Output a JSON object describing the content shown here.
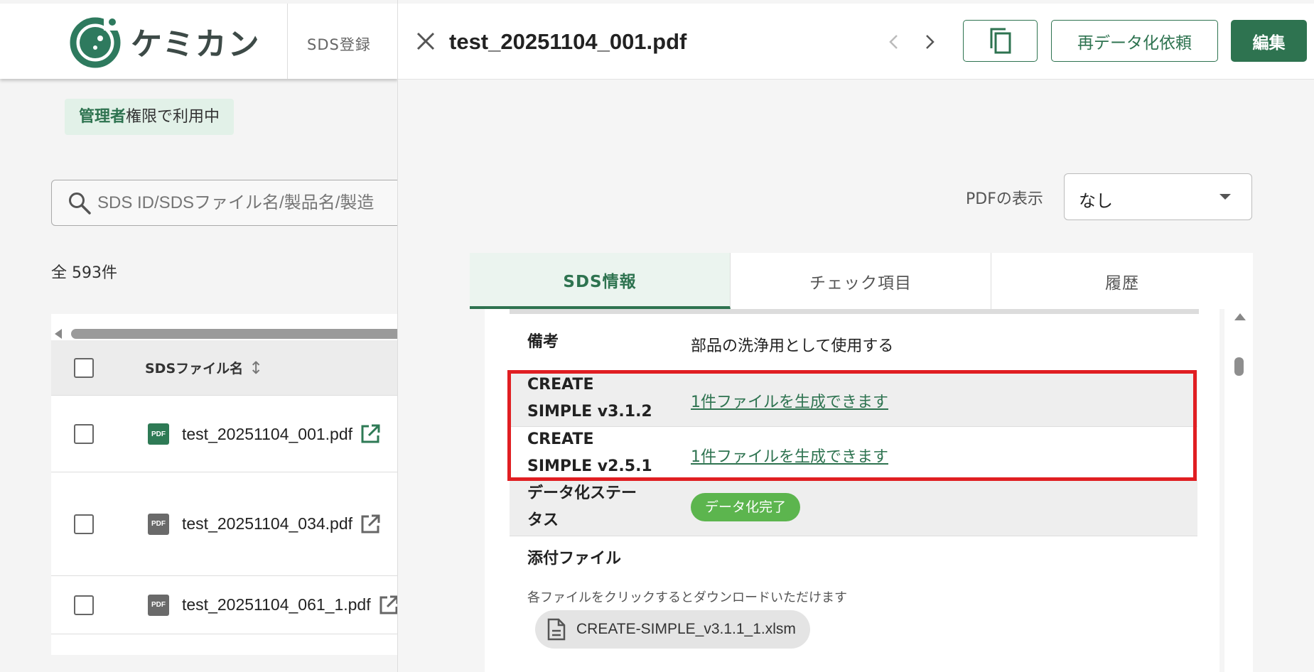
{
  "app": {
    "logo_text": "ケミカン",
    "nav_sds_register": "SDS登録"
  },
  "admin_badge": {
    "strong": "管理者",
    "rest": "権限で利用中"
  },
  "search": {
    "placeholder": "SDS ID/SDSファイル名/製品名/製造"
  },
  "total_count": "全 593件",
  "table": {
    "header_filename": "SDSファイル名",
    "rows": [
      {
        "name": "test_20251104_001.pdf",
        "icon_label": "PDF"
      },
      {
        "name": "test_20251104_034.pdf",
        "icon_label": "PDF"
      },
      {
        "name": "test_20251104_061_1.pdf",
        "icon_label": "PDF"
      }
    ]
  },
  "panel": {
    "title": "test_20251104_001.pdf",
    "redata_label": "再データ化依頼",
    "edit_label": "編集",
    "pdf_label": "PDFの表示",
    "pdf_select_value": "なし",
    "tabs": [
      {
        "label": "SDS情報",
        "active": true
      },
      {
        "label": "チェック項目",
        "active": false
      },
      {
        "label": "履歴",
        "active": false
      }
    ],
    "fields": {
      "remarks_label": "備考",
      "remarks_value": "部品の洗浄用として使用する",
      "cs312_label_1": "CREATE",
      "cs312_label_2": "SIMPLE v3.1.2",
      "cs312_link": "1件ファイルを生成できます",
      "cs251_label_1": "CREATE",
      "cs251_label_2": "SIMPLE v2.5.1",
      "cs251_link": "1件ファイルを生成できます",
      "status_label_1": "データ化ステー",
      "status_label_2": "タス",
      "status_value": "データ化完了",
      "attach_label": "添付ファイル",
      "attach_desc": "各ファイルをクリックするとダウンロードいただけます",
      "attach_file": "CREATE-SIMPLE_v3.1.1_1.xlsm"
    }
  },
  "colors": {
    "brand_green": "#2e7350",
    "highlight_red": "#e01e22",
    "status_green": "#5cb54e"
  }
}
